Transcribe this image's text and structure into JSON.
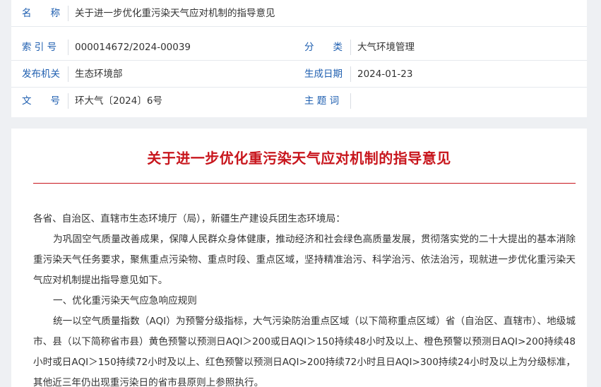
{
  "meta": {
    "name_label": "名　　称",
    "name_value": "关于进一步优化重污染天气应对机制的指导意见",
    "index_label": "索 引 号",
    "index_value": "000014672/2024-00039",
    "category_label": "分　　类",
    "category_value": "大气环境管理",
    "issuer_label": "发布机关",
    "issuer_value": "生态环境部",
    "date_label": "生成日期",
    "date_value": "2024-01-23",
    "docno_label": "文　　号",
    "docno_value": "环大气〔2024〕6号",
    "keywords_label": "主 题 词",
    "keywords_value": ""
  },
  "document": {
    "title": "关于进一步优化重污染天气应对机制的指导意见",
    "salutation": "各省、自治区、直辖市生态环境厅（局），新疆生产建设兵团生态环境局：",
    "para1": "为巩固空气质量改善成果，保障人民群众身体健康，推动经济和社会绿色高质量发展，贯彻落实党的二十大提出的基本消除重污染天气任务要求，聚焦重点污染物、重点时段、重点区域，坚持精准治污、科学治污、依法治污，现就进一步优化重污染天气应对机制提出指导意见如下。",
    "section1": "一、优化重污染天气应急响应规则",
    "para2": "统一以空气质量指数（AQI）为预警分级指标，大气污染防治重点区域（以下简称重点区域）省（自治区、直辖市）、地级城市、县（以下简称省市县）黄色预警以预测日AQI＞200或日AQI＞150持续48小时及以上、橙色预警以预测日AQI>200持续48小时或日AQI＞150持续72小时及以上、红色预警以预测日AQI>200持续72小时且日AQI>300持续24小时及以上为分级标准，其他近三年仍出现重污染日的省市县原则上参照执行。"
  }
}
